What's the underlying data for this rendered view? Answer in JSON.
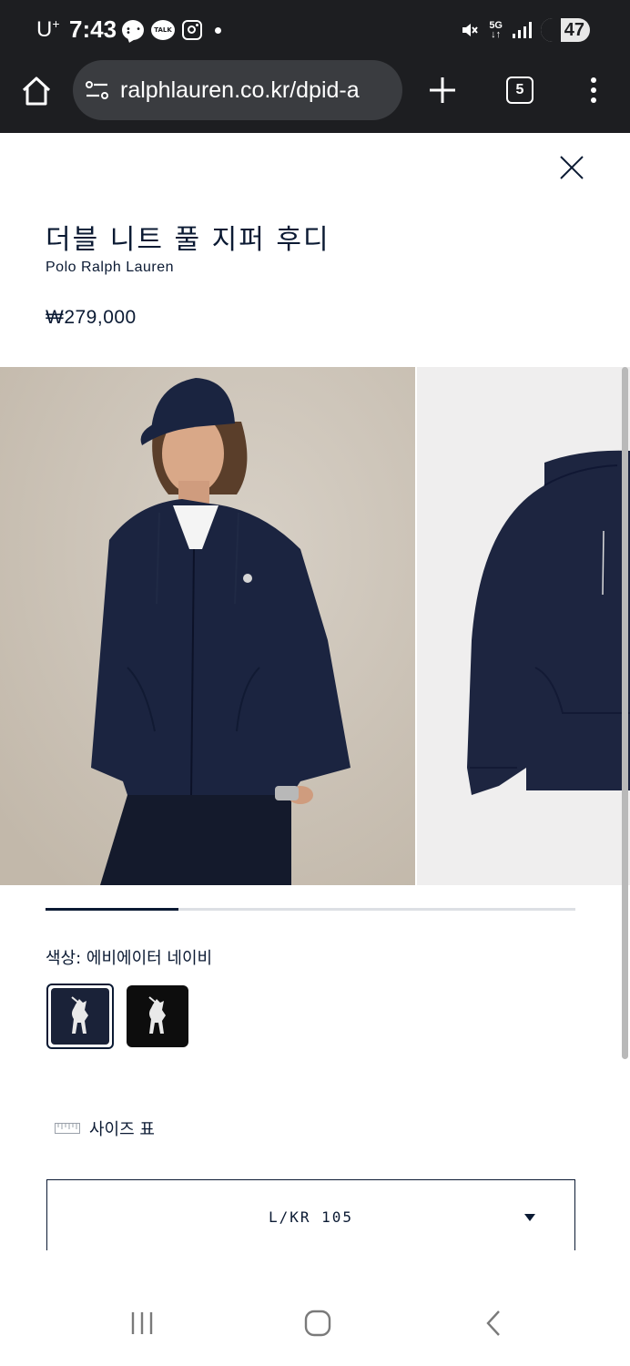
{
  "status_bar": {
    "carrier": "U",
    "carrier_sup": "+",
    "time": "7:43",
    "talk_label": "TALK",
    "network": "5G",
    "battery": "47"
  },
  "browser": {
    "url": "ralphlauren.co.kr/dpid-a",
    "tab_count": "5"
  },
  "product": {
    "title": "더블 니트 풀 지퍼 후디",
    "brand": "Polo Ralph Lauren",
    "price": "₩279,000"
  },
  "gallery": {
    "progress": 0.25
  },
  "color": {
    "label": "색상: 에비에이터 네이비",
    "swatches": [
      {
        "name": "navy",
        "color": "#1a2238",
        "selected": true
      },
      {
        "name": "black",
        "color": "#0d0d0d",
        "selected": false
      }
    ]
  },
  "size": {
    "chart_label": "사이즈 표",
    "selected": "L/KR 105"
  },
  "colors": {
    "navy": "#0b1a33",
    "bar": "#1d1e21"
  }
}
